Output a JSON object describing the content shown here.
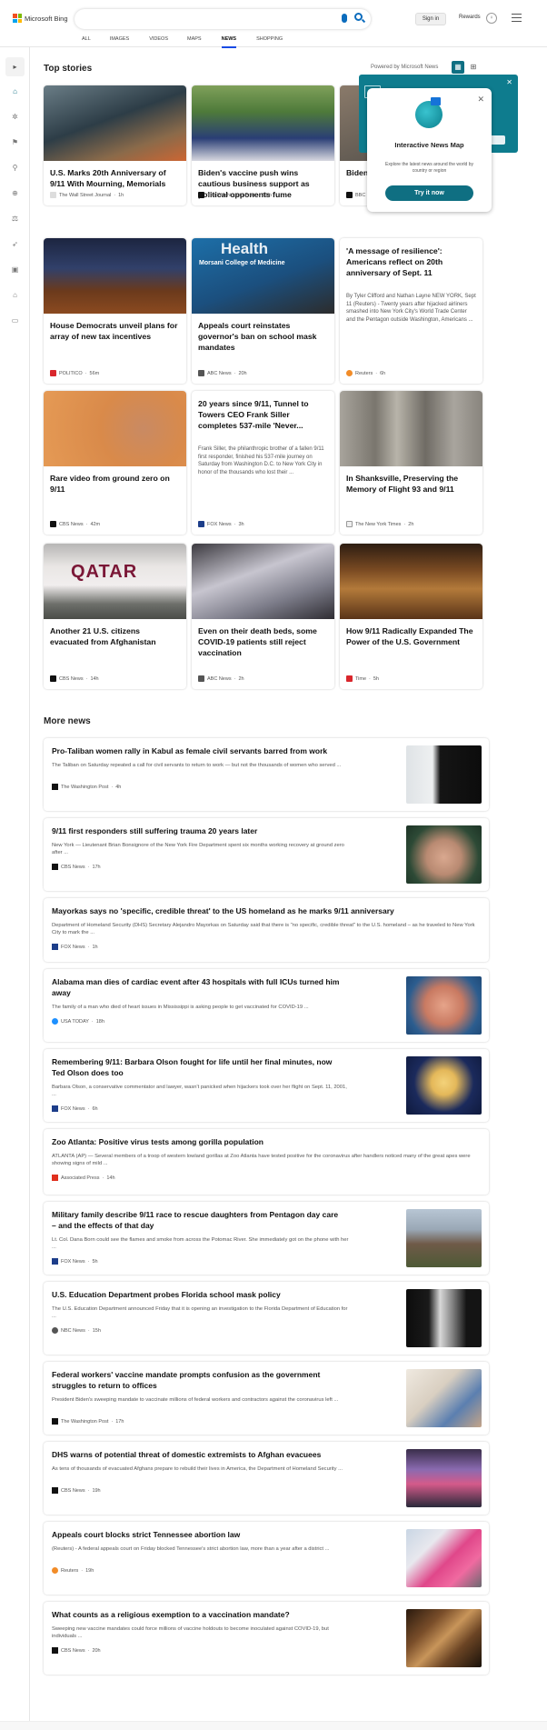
{
  "header": {
    "brand": "Microsoft Bing",
    "signin": "Sign in",
    "rewards": "Rewards",
    "tabs": [
      "ALL",
      "IMAGES",
      "VIDEOS",
      "MAPS",
      "NEWS",
      "SHOPPING"
    ],
    "active_tab": "NEWS"
  },
  "top_stories": {
    "title": "Top stories",
    "powered_by": "Powered by Microsoft News",
    "cards": [
      {
        "headline": "U.S. Marks 20th Anniversary of 9/11 With Mourning, Memorials",
        "source": "The Wall Street Journal",
        "time": "1h",
        "desc": ""
      },
      {
        "headline": "Biden's vaccine push wins cautious business support as political opponents fume",
        "source": "The Washington Post",
        "time": "36m",
        "desc": ""
      },
      {
        "headline": "Biden",
        "source": "BBC News",
        "time": "23h",
        "desc": ""
      },
      {
        "headline": "House Democrats unveil plans for array of new tax incentives",
        "source": "POLITICO",
        "time": "56m",
        "desc": ""
      },
      {
        "headline": "Appeals court reinstates governor's ban on school mask mandates",
        "source": "ABC News",
        "time": "20h",
        "desc": ""
      },
      {
        "headline": "'A message of resilience': Americans reflect on 20th anniversary of Sept. 11",
        "source": "Reuters",
        "time": "6h",
        "desc": "By Tyler Clifford and Nathan Layne NEW YORK, Sept 11 (Reuters) - Twenty years after hijacked airliners smashed into New York City's World Trade Center and the Pentagon outside Washington, Americans ..."
      },
      {
        "headline": "Rare video from ground zero on 9/11",
        "source": "CBS News",
        "time": "42m",
        "desc": ""
      },
      {
        "headline": "20 years since 9/11, Tunnel to Towers CEO Frank Siller completes 537-mile 'Never...",
        "source": "FOX News",
        "time": "3h",
        "desc": "Frank Siller, the philanthropic brother of a fallen 9/11 first responder, finished his 537-mile journey on Saturday from Washington D.C. to New York City in honor of the thousands who lost their ..."
      },
      {
        "headline": "In Shanksville, Preserving the Memory of Flight 93 and 9/11",
        "source": "The New York Times",
        "time": "2h",
        "desc": ""
      },
      {
        "headline": "Another 21 U.S. citizens evacuated from Afghanistan",
        "source": "CBS News",
        "time": "14h",
        "desc": ""
      },
      {
        "headline": "Even on their death beds, some COVID-19 patients still reject vaccination",
        "source": "ABC News",
        "time": "2h",
        "desc": ""
      },
      {
        "headline": "How 9/11 Radically Expanded The Power of the U.S. Government",
        "source": "Time",
        "time": "5h",
        "desc": ""
      }
    ],
    "overlay_text": {
      "img_caption": "Health",
      "img_caption2": "Morsani College of Medicine"
    }
  },
  "popup": {
    "title": "Interactive News Map",
    "desc": "Explore the latest news around the world by country or region",
    "button": "Try it now"
  },
  "more_news": {
    "title": "More news",
    "items": [
      {
        "headline": "Pro-Taliban women rally in Kabul as female civil servants barred from work",
        "snippet": "The Taliban on Saturday repeated a call for civil servants to return to work — but not the thousands of women who served ...",
        "source": "The Washington Post",
        "time": "4h"
      },
      {
        "headline": "9/11 first responders still suffering trauma 20 years later",
        "snippet": "New York — Lieutenant Brian Bonsignore of the New York Fire Department spent six months working recovery at ground zero after ...",
        "source": "CBS News",
        "time": "17h"
      },
      {
        "headline": "Mayorkas says no 'specific, credible threat' to the US homeland as he marks 9/11 anniversary",
        "snippet": "Department of Homeland Security (DHS) Secretary Alejandro Mayorkas on Saturday said that there is \"no specific, credible threat\" to the U.S. homeland – as he traveled to New York City to mark the ...",
        "source": "FOX News",
        "time": "1h"
      },
      {
        "headline": "Alabama man dies of cardiac event after 43 hospitals with full ICUs turned him away",
        "snippet": "The family of a man who died of heart issues in Mississippi is asking people to get vaccinated for COVID-19 ...",
        "source": "USA TODAY",
        "time": "18h"
      },
      {
        "headline": "Remembering 9/11: Barbara Olson fought for life until her final minutes, now Ted Olson does too",
        "snippet": "Barbara Olson, a conservative commentator and lawyer, wasn't panicked when hijackers took over her flight on Sept. 11, 2001, ...",
        "source": "FOX News",
        "time": "6h"
      },
      {
        "headline": "Zoo Atlanta: Positive virus tests among gorilla population",
        "snippet": "ATLANTA (AP) — Several members of a troop of western lowland gorillas at Zoo Atlanta have tested positive for the coronavirus after handlers noticed many of the great apes were showing signs of mild ...",
        "source": "Associated Press",
        "time": "14h"
      },
      {
        "headline": "Military family describe 9/11 race to rescue daughters from Pentagon day care – and the effects of that day",
        "snippet": "Lt. Col. Dana Born could see the flames and smoke from across the Potomac River. She immediately got on the phone with her ...",
        "source": "FOX News",
        "time": "5h"
      },
      {
        "headline": "U.S. Education Department probes Florida school mask policy",
        "snippet": "The U.S. Education Department announced Friday that it is opening an investigation to the Florida Department of Education for ...",
        "source": "NBC News",
        "time": "15h"
      },
      {
        "headline": "Federal workers' vaccine mandate prompts confusion as the government struggles to return to offices",
        "snippet": "President Biden's sweeping mandate to vaccinate millions of federal workers and contractors against the coronavirus left ...",
        "source": "The Washington Post",
        "time": "17h"
      },
      {
        "headline": "DHS warns of potential threat of domestic extremists to Afghan evacuees",
        "snippet": "As tens of thousands of evacuated Afghans prepare to rebuild their lives in America, the Department of Homeland Security ...",
        "source": "CBS News",
        "time": "19h"
      },
      {
        "headline": "Appeals court blocks strict Tennessee abortion law",
        "snippet": "(Reuters) - A federal appeals court on Friday blocked Tennessee's strict abortion law, more than a year after a district ...",
        "source": "Reuters",
        "time": "19h"
      },
      {
        "headline": "What counts as a religious exemption to a vaccination mandate?",
        "snippet": "Sweeping new vaccine mandates could force millions of vaccine holdouts to become inoculated against COVID-19, but individuals ...",
        "source": "CBS News",
        "time": "20h"
      }
    ]
  },
  "colors": {
    "accent": "#174ae4",
    "teal": "#0f6f82",
    "rail": "#e6e6e6"
  }
}
